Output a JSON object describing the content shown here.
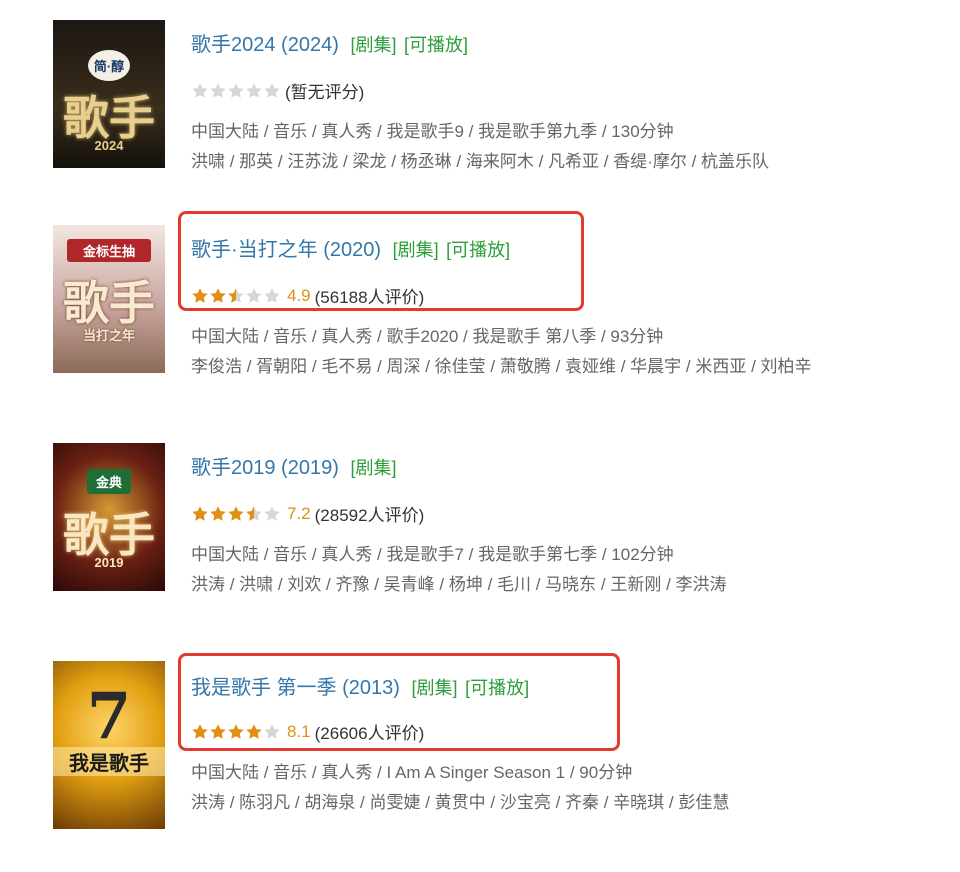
{
  "results": [
    {
      "title": "歌手2024 (2024)",
      "tags": [
        "[剧集]",
        "[可播放]"
      ],
      "score": "",
      "rating_text": "(暂无评分)",
      "stars": 0,
      "meta": "中国大陆 / 音乐 / 真人秀 / 我是歌手9 / 我是歌手第九季 / 130分钟",
      "cast": "洪啸 / 那英 / 汪苏泷 / 梁龙 / 杨丞琳 / 海来阿木 / 凡希亚 / 香缇·摩尔 / 杭盖乐队",
      "poster_text": [
        "简·醇",
        "歌手",
        "2024"
      ],
      "poster_colors": [
        "#1b1712",
        "#3a2e1c"
      ]
    },
    {
      "title": "歌手·当打之年 (2020)",
      "tags": [
        "[剧集]",
        "[可播放]"
      ],
      "score": "4.9",
      "rating_text": "(56188人评价)",
      "stars": 2.5,
      "meta": "中国大陆 / 音乐 / 真人秀 / 歌手2020 / 我是歌手 第八季 / 93分钟",
      "cast": "李俊浩 / 胥朝阳 / 毛不易 / 周深 / 徐佳莹 / 萧敬腾 / 袁娅维 / 华晨宇 / 米西亚 / 刘柏辛",
      "poster_text": [
        "金标生抽",
        "歌手",
        "当打之年"
      ],
      "poster_colors": [
        "#f3e6e0",
        "#c9a6a0"
      ]
    },
    {
      "title": "歌手2019 (2019)",
      "tags": [
        "[剧集]"
      ],
      "score": "7.2",
      "rating_text": "(28592人评价)",
      "stars": 3.5,
      "meta": "中国大陆 / 音乐 / 真人秀 / 我是歌手7 / 我是歌手第七季 / 102分钟",
      "cast": "洪涛 / 洪啸 / 刘欢 / 齐豫 / 吴青峰 / 杨坤 / 毛川 / 马晓东 / 王新刚 / 李洪涛",
      "poster_text": [
        "金典",
        "歌手",
        "2019"
      ],
      "poster_colors": [
        "#3b0d0d",
        "#b8862b"
      ]
    },
    {
      "title": "我是歌手 第一季 (2013)",
      "tags": [
        "[剧集]",
        "[可播放]"
      ],
      "score": "8.1",
      "rating_text": "(26606人评价)",
      "stars": 4,
      "meta": "中国大陆 / 音乐 / 真人秀 / I Am A Singer Season 1 / 90分钟",
      "cast": "洪涛 / 陈羽凡 / 胡海泉 / 尚雯婕 / 黄贯中 / 沙宝亮 / 齐秦 / 辛晓琪 / 彭佳慧",
      "poster_text": [
        "7",
        "我是歌手"
      ],
      "poster_colors": [
        "#e2a011",
        "#6b3a06"
      ]
    }
  ],
  "colors": {
    "link": "#3377aa",
    "tag": "#2e9e3b",
    "score": "#e09015",
    "highlight": "#e23a2f"
  },
  "icons": {
    "star_full": "star-full-icon",
    "star_half": "star-half-icon",
    "star_empty": "star-empty-icon"
  }
}
